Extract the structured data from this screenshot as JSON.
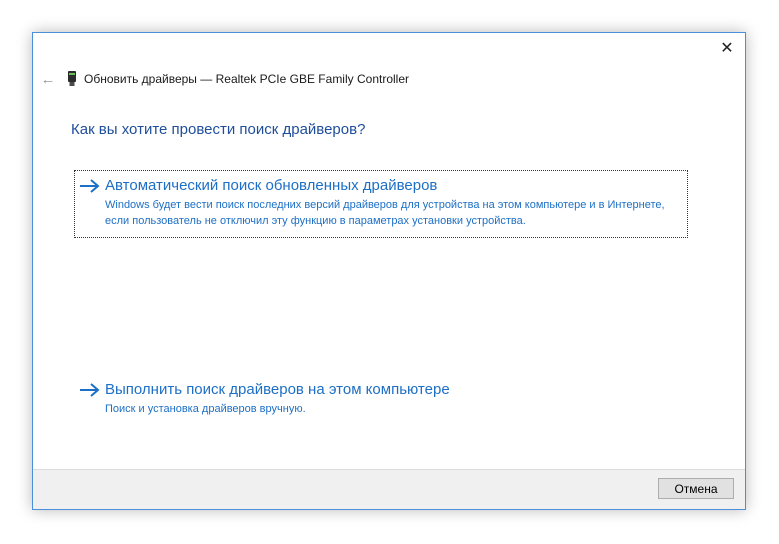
{
  "window": {
    "title": "Обновить драйверы — Realtek PCIe GBE Family Controller",
    "close_glyph": "✕",
    "back_glyph": "←",
    "accent_color": "#1d6fc5"
  },
  "main": {
    "heading": "Как вы хотите провести поиск драйверов?",
    "options": [
      {
        "title": "Автоматический поиск обновленных драйверов",
        "description": "Windows будет вести поиск последних версий драйверов для устройства на этом компьютере и в Интернете, если пользователь не отключил эту функцию в параметрах установки устройства.",
        "icon": "arrow-right-icon"
      },
      {
        "title": "Выполнить поиск драйверов на этом компьютере",
        "description": "Поиск и установка драйверов вручную.",
        "icon": "arrow-right-icon"
      }
    ]
  },
  "footer": {
    "cancel_label": "Отмена"
  }
}
